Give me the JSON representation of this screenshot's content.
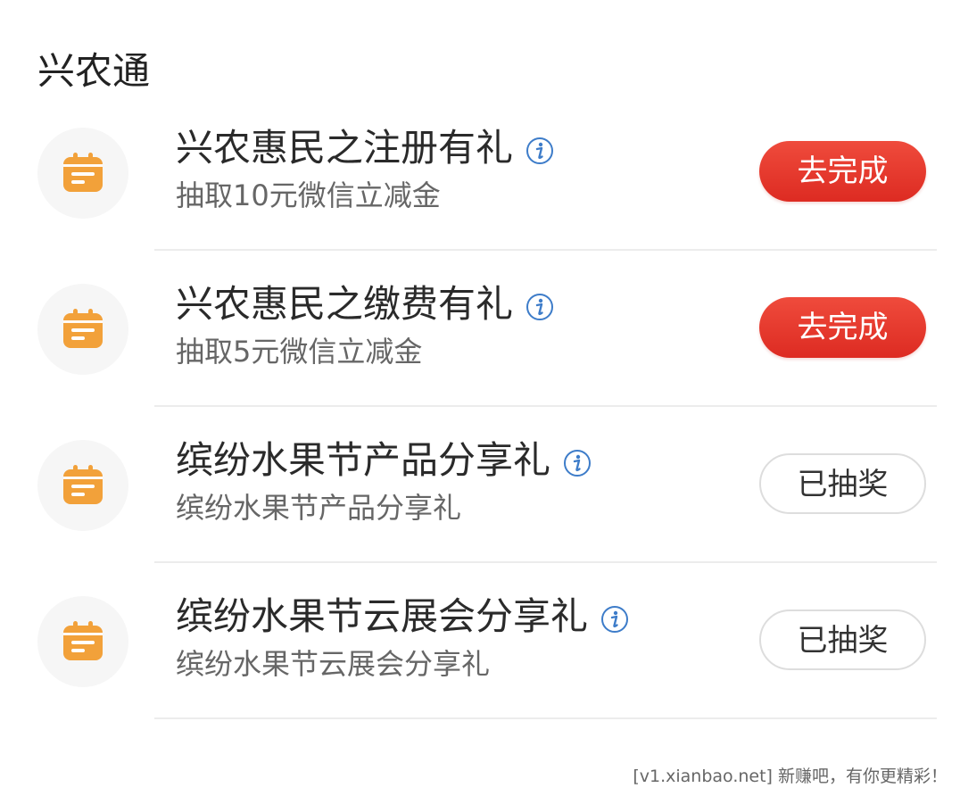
{
  "section": {
    "title": "兴农通"
  },
  "tasks": [
    {
      "title": "兴农惠民之注册有礼",
      "subtitle": "抽取10元微信立减金",
      "button_label": "去完成",
      "button_state": "pending",
      "icon": "calendar-icon"
    },
    {
      "title": "兴农惠民之缴费有礼",
      "subtitle": "抽取5元微信立减金",
      "button_label": "去完成",
      "button_state": "pending",
      "icon": "calendar-icon"
    },
    {
      "title": "缤纷水果节产品分享礼",
      "subtitle": "缤纷水果节产品分享礼",
      "button_label": "已抽奖",
      "button_state": "done",
      "icon": "calendar-icon"
    },
    {
      "title": "缤纷水果节云展会分享礼",
      "subtitle": "缤纷水果节云展会分享礼",
      "button_label": "已抽奖",
      "button_state": "done",
      "icon": "calendar-icon"
    }
  ],
  "watermark": "[v1.xianbao.net] 新赚吧，有你更精彩！",
  "colors": {
    "primary_button": "#e53a2e",
    "icon_orange": "#f2a13a",
    "info_blue": "#3d7cc9",
    "divider": "#ececec"
  }
}
